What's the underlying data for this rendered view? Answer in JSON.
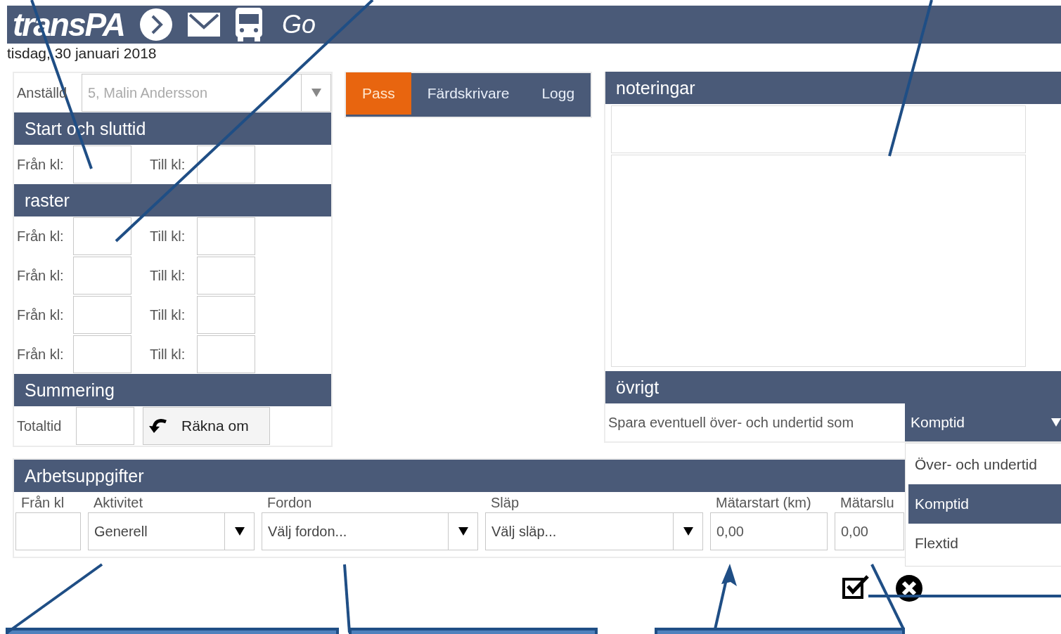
{
  "header": {
    "logo": "transPA",
    "go_link": "Go"
  },
  "date": "tisdag, 30 januari 2018",
  "employee": {
    "label": "Anställd",
    "value": "5, Malin Andersson",
    "disabled": true
  },
  "start_section": {
    "title": "Start och sluttid",
    "rows": [
      {
        "from_label": "Från kl:",
        "to_label": "Till kl:"
      }
    ]
  },
  "breaks": {
    "title": "raster",
    "rows": [
      {
        "from_label": "Från kl:",
        "to_label": "Till kl:"
      },
      {
        "from_label": "Från kl:",
        "to_label": "Till kl:"
      },
      {
        "from_label": "Från kl:",
        "to_label": "Till kl:"
      },
      {
        "from_label": "Från kl:",
        "to_label": "Till kl:"
      }
    ]
  },
  "summary": {
    "title": "Summering",
    "total_label": "Totaltid",
    "recalc_button": "Räkna om"
  },
  "tabs": [
    {
      "label": "Pass",
      "selected": true
    },
    {
      "label": "Färdskrivare",
      "selected": false
    },
    {
      "label": "Logg",
      "selected": false
    }
  ],
  "notes": {
    "title": "noteringar"
  },
  "other": {
    "title": "övrigt",
    "label": "Spara eventuell över- och undertid som",
    "select_value": "Komptid",
    "options": [
      {
        "label": "Över- och undertid",
        "selected": false
      },
      {
        "label": "Komptid",
        "selected": true
      },
      {
        "label": "Flextid",
        "selected": false
      }
    ]
  },
  "tasks": {
    "title": "Arbetsuppgifter",
    "columns": [
      {
        "label": "Från kl",
        "kind": "input"
      },
      {
        "label": "Aktivitet",
        "kind": "select",
        "value": "Generell"
      },
      {
        "label": "Fordon",
        "kind": "select",
        "value": "Välj fordon..."
      },
      {
        "label": "Släp",
        "kind": "select",
        "value": "Välj släp..."
      },
      {
        "label": "Mätarstart (km)",
        "kind": "input",
        "value": "0,00"
      },
      {
        "label": "Mätarslu",
        "kind": "input",
        "value": "0,00"
      }
    ]
  }
}
